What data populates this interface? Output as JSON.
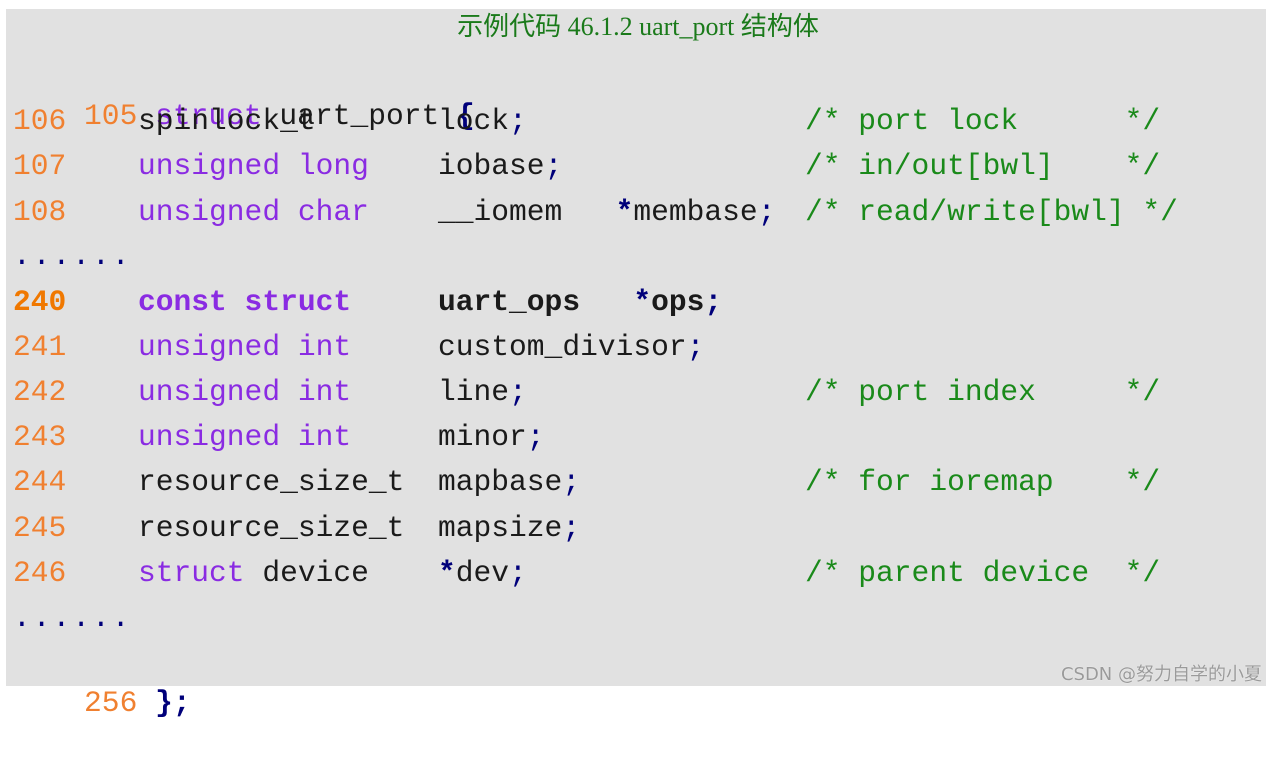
{
  "caption": "示例代码 46.1.2 uart_port 结构体",
  "watermark": "CSDN @努力自学的小夏",
  "colors": {
    "background": "#e1e1e1",
    "line_number": "#f08030",
    "keyword": "#8a2be2",
    "identifier": "#1a1a1a",
    "comment": "#1a8a1a",
    "punctuation": "#00007a",
    "caption": "#1a7a1a"
  },
  "code": {
    "header": {
      "ln": "105",
      "kw": "struct",
      "name": "uart_port",
      "brace": "{"
    },
    "lines": [
      {
        "ln": "106",
        "type_kw": "",
        "type_id": "spinlock_t",
        "name_pre": "",
        "ptr": "",
        "name": "lock",
        "semi": ";",
        "comment": "/* port lock      */"
      },
      {
        "ln": "107",
        "type_kw": "unsigned long",
        "type_id": "",
        "name_pre": "",
        "ptr": "",
        "name": "iobase",
        "semi": ";",
        "comment": "/* in/out[bwl]    */"
      },
      {
        "ln": "108",
        "type_kw": "unsigned char",
        "type_id": "",
        "name_pre": "__iomem   ",
        "ptr": "*",
        "name": "membase",
        "semi": ";",
        "comment": "/* read/write[bwl] */"
      }
    ],
    "ellipsis_1": "......",
    "lines2": [
      {
        "ln": "240",
        "type_kw": "const struct",
        "type_id": "",
        "name_pre": "uart_ops   ",
        "ptr": "*",
        "name": "ops",
        "semi": ";",
        "comment": "",
        "bold": true
      },
      {
        "ln": "241",
        "type_kw": "unsigned int",
        "type_id": "",
        "name_pre": "",
        "ptr": "",
        "name": "custom_divisor",
        "semi": ";",
        "comment": ""
      },
      {
        "ln": "242",
        "type_kw": "unsigned int",
        "type_id": "",
        "name_pre": "",
        "ptr": "",
        "name": "line",
        "semi": ";",
        "comment": "/* port index     */"
      },
      {
        "ln": "243",
        "type_kw": "unsigned int",
        "type_id": "",
        "name_pre": "",
        "ptr": "",
        "name": "minor",
        "semi": ";",
        "comment": ""
      },
      {
        "ln": "244",
        "type_kw": "",
        "type_id": "resource_size_t",
        "name_pre": "",
        "ptr": "",
        "name": "mapbase",
        "semi": ";",
        "comment": "/* for ioremap    */"
      },
      {
        "ln": "245",
        "type_kw": "",
        "type_id": "resource_size_t",
        "name_pre": "",
        "ptr": "",
        "name": "mapsize",
        "semi": ";",
        "comment": ""
      },
      {
        "ln": "246",
        "type_kw": "struct",
        "type_id": " device",
        "name_pre": "",
        "ptr": "*",
        "name": "dev",
        "semi": ";",
        "comment": "/* parent device  */"
      }
    ],
    "ellipsis_2": "......",
    "footer": {
      "ln": "256",
      "brace": "};"
    }
  }
}
